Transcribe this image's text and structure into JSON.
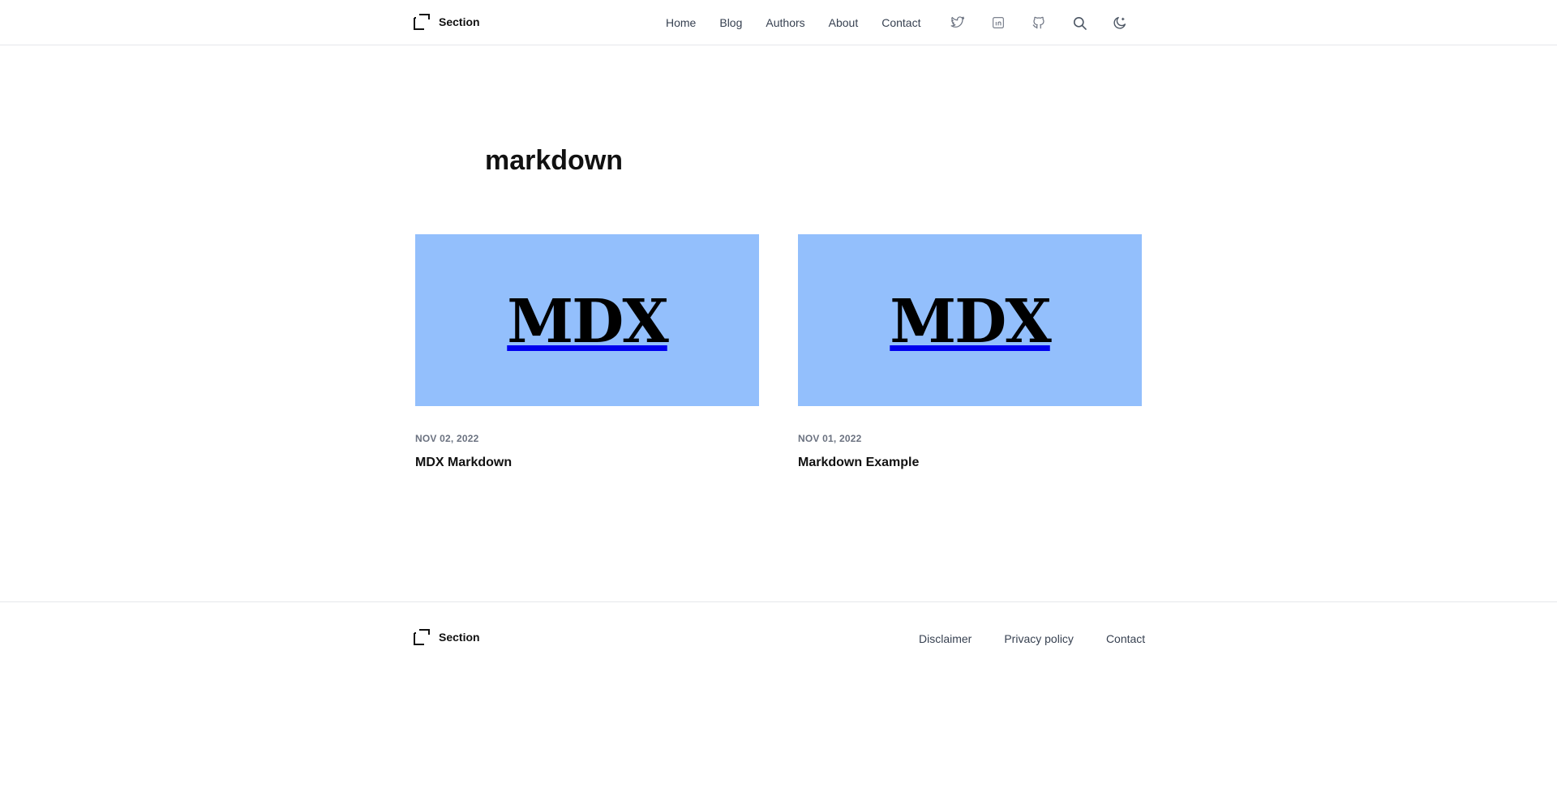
{
  "header": {
    "logo_text": "Section",
    "nav": [
      "Home",
      "Blog",
      "Authors",
      "About",
      "Contact"
    ],
    "icons": [
      "twitter-icon",
      "linkedin-icon",
      "github-icon",
      "search-icon",
      "theme-toggle-icon"
    ]
  },
  "page": {
    "title": "markdown"
  },
  "posts": [
    {
      "thumb_text": "MDX",
      "date": "NOV 02, 2022",
      "title": "MDX Markdown"
    },
    {
      "thumb_text": "MDX",
      "date": "NOV 01, 2022",
      "title": "Markdown Example"
    }
  ],
  "footer": {
    "logo_text": "Section",
    "links": [
      "Disclaimer",
      "Privacy policy",
      "Contact"
    ]
  },
  "colors": {
    "thumb_bg": "#93bffc",
    "border": "#e5e7eb",
    "muted_text": "#6b7280"
  }
}
